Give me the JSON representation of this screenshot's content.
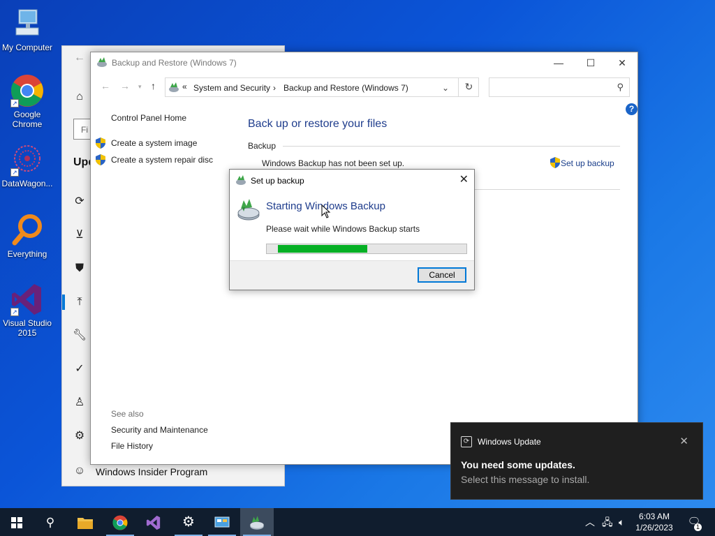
{
  "desktop": {
    "icons": [
      {
        "label": "My Computer"
      },
      {
        "label": "Google Chrome"
      },
      {
        "label": "DataWagon..."
      },
      {
        "label": "Everything"
      },
      {
        "label": "Visual Studio 2015"
      }
    ]
  },
  "settings_window": {
    "search_placeholder": "Fi",
    "heading": "Upd",
    "insider_label": "Windows Insider Program"
  },
  "cp_window": {
    "title": "Backup and Restore (Windows 7)",
    "address": {
      "prefix": "«",
      "crumbs": [
        "System and Security",
        "Backup and Restore (Windows 7)"
      ]
    },
    "left_nav": {
      "home": "Control Panel Home",
      "links": [
        "Create a system image",
        "Create a system repair disc"
      ],
      "see_also_label": "See also",
      "see_also": [
        "Security and Maintenance",
        "File History"
      ]
    },
    "main": {
      "title": "Back up or restore your files",
      "section": "Backup",
      "status": "Windows Backup has not been set up.",
      "setup_link": "Set up backup"
    }
  },
  "modal": {
    "title": "Set up backup",
    "heading": "Starting Windows Backup",
    "message": "Please wait while Windows Backup starts",
    "progress": 0.5,
    "cancel_label": "Cancel"
  },
  "toast": {
    "app": "Windows Update",
    "heading": "You need some updates.",
    "body": "Select this message to install."
  },
  "taskbar": {
    "time": "6:03 AM",
    "date": "1/26/2023",
    "notification_count": "1"
  },
  "colors": {
    "accent": "#0078d7",
    "link": "#1a3e8a",
    "progress": "#06b025",
    "taskbar": "#101d2e"
  }
}
